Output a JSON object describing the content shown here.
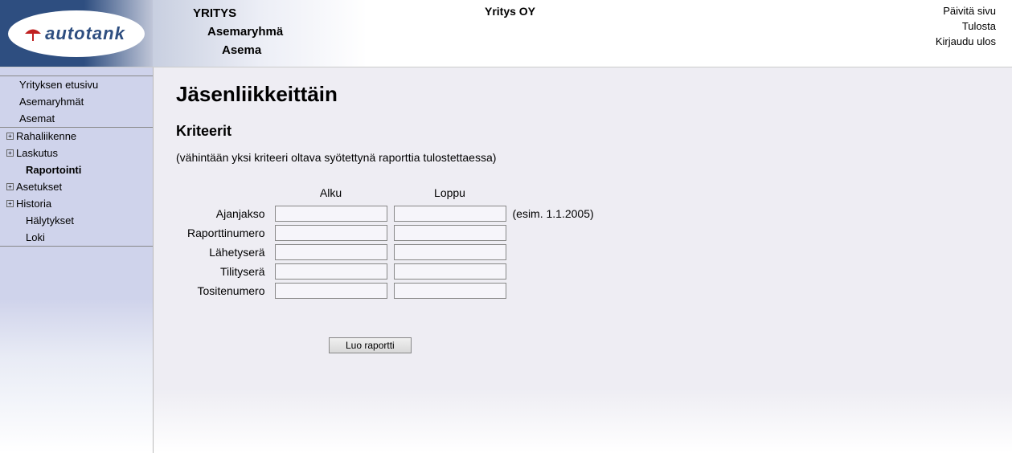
{
  "header": {
    "logo_text": "autotank",
    "level1": "YRITYS",
    "level2": "Asemaryhmä",
    "level3": "Asema",
    "company": "Yritys OY",
    "links": {
      "refresh": "Päivitä sivu",
      "print": "Tulosta",
      "logout": "Kirjaudu ulos"
    }
  },
  "sidebar": {
    "group1": [
      {
        "label": "Yrityksen etusivu",
        "expandable": false
      },
      {
        "label": "Asemaryhmät",
        "expandable": false
      },
      {
        "label": "Asemat",
        "expandable": false
      }
    ],
    "group2": [
      {
        "label": "Rahaliikenne",
        "expandable": true
      },
      {
        "label": "Laskutus",
        "expandable": true
      },
      {
        "label": "Raportointi",
        "expandable": false,
        "level": 2,
        "bold": true
      },
      {
        "label": "Asetukset",
        "expandable": true
      },
      {
        "label": "Historia",
        "expandable": true
      },
      {
        "label": "Hälytykset",
        "expandable": false,
        "level": 2
      },
      {
        "label": "Loki",
        "expandable": false,
        "level": 2
      }
    ]
  },
  "main": {
    "title": "Jäsenliikkeittäin",
    "subtitle": "Kriteerit",
    "hint": "(vähintään yksi kriteeri oltava syötettynä raporttia tulostettaessa)",
    "col_start": "Alku",
    "col_end": "Loppu",
    "rows": [
      {
        "label": "Ajanjakso",
        "hint": "(esim. 1.1.2005)"
      },
      {
        "label": "Raporttinumero"
      },
      {
        "label": "Lähetyserä"
      },
      {
        "label": "Tilityserä"
      },
      {
        "label": "Tositenumero"
      }
    ],
    "submit_label": "Luo raportti"
  }
}
